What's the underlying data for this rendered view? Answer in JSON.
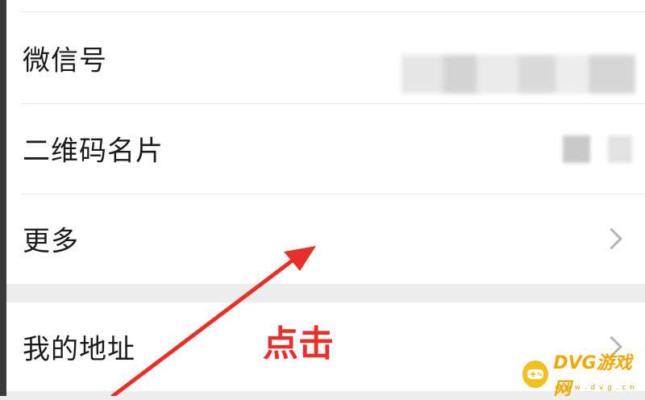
{
  "settings": {
    "rows": [
      {
        "label": "微信号"
      },
      {
        "label": "二维码名片"
      },
      {
        "label": "更多"
      },
      {
        "label": "我的地址"
      }
    ]
  },
  "annotation": {
    "text": "点击",
    "color": "#e8302b"
  },
  "watermark": {
    "text": "DVG游戏网",
    "sub": "w w w . d v g . c n",
    "color": "#f4a700"
  }
}
